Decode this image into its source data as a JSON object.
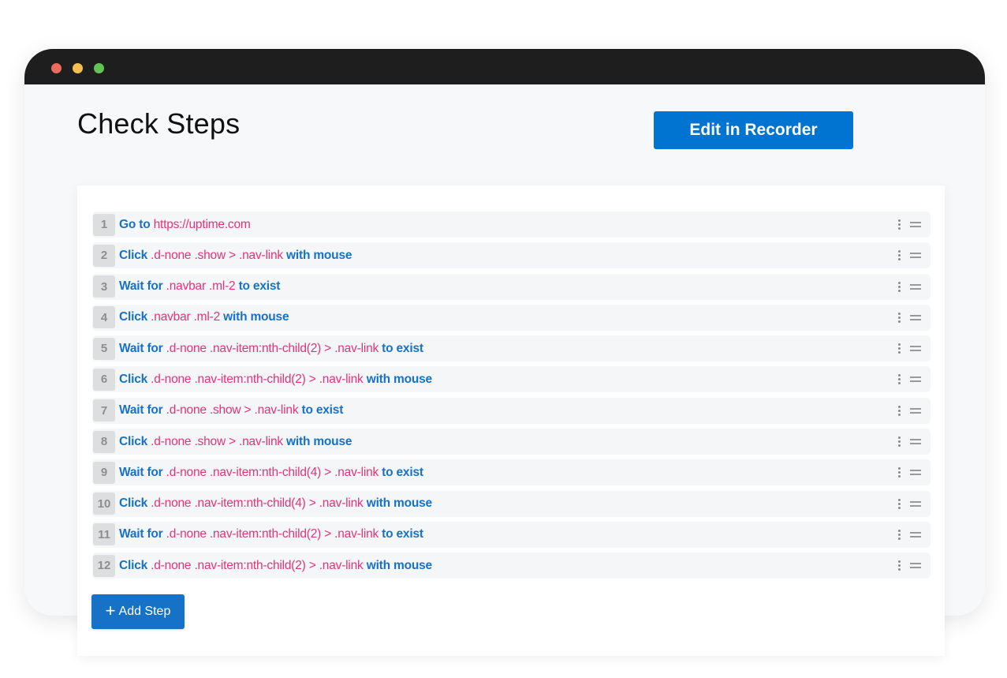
{
  "window": {
    "controls": [
      "close",
      "minimize",
      "maximize"
    ]
  },
  "header": {
    "title": "Check Steps",
    "edit_button_label": "Edit in Recorder"
  },
  "steps": [
    {
      "number": "1",
      "action": "Go to",
      "target": "https://uptime.com",
      "suffix": ""
    },
    {
      "number": "2",
      "action": "Click",
      "target": ".d-none .show > .nav-link",
      "suffix": "with mouse"
    },
    {
      "number": "3",
      "action": "Wait for",
      "target": ".navbar .ml-2",
      "suffix": "to exist"
    },
    {
      "number": "4",
      "action": "Click",
      "target": ".navbar .ml-2",
      "suffix": "with mouse"
    },
    {
      "number": "5",
      "action": "Wait for",
      "target": ".d-none .nav-item:nth-child(2) > .nav-link",
      "suffix": "to exist"
    },
    {
      "number": "6",
      "action": "Click",
      "target": ".d-none .nav-item:nth-child(2) > .nav-link",
      "suffix": "with mouse"
    },
    {
      "number": "7",
      "action": "Wait for",
      "target": ".d-none .show > .nav-link",
      "suffix": "to exist"
    },
    {
      "number": "8",
      "action": "Click",
      "target": ".d-none .show > .nav-link",
      "suffix": "with mouse"
    },
    {
      "number": "9",
      "action": "Wait for",
      "target": ".d-none .nav-item:nth-child(4) > .nav-link",
      "suffix": "to exist"
    },
    {
      "number": "10",
      "action": "Click",
      "target": ".d-none .nav-item:nth-child(4) > .nav-link",
      "suffix": "with mouse"
    },
    {
      "number": "11",
      "action": "Wait for",
      "target": ".d-none .nav-item:nth-child(2) > .nav-link",
      "suffix": "to exist"
    },
    {
      "number": "12",
      "action": "Click",
      "target": ".d-none .nav-item:nth-child(2) > .nav-link",
      "suffix": "with mouse"
    }
  ],
  "footer": {
    "add_step_icon": "+",
    "add_step_label": "Add Step"
  },
  "colors": {
    "primary": "#0074d0",
    "keyword": "#1672c7",
    "selector": "#e3337a",
    "titlebar": "#1e1e1e"
  },
  "icons": {
    "step_menu": "kebab-menu-icon",
    "step_drag": "drag-handle-icon"
  }
}
